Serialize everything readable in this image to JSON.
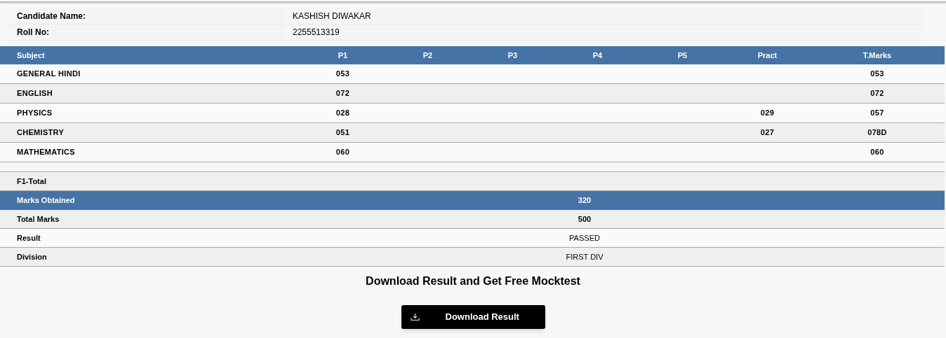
{
  "candidate": [
    {
      "label": "Candidate Name:",
      "value": "KASHISH DIWAKAR"
    },
    {
      "label": "Roll No:",
      "value": "2255513319"
    }
  ],
  "marks_table": {
    "columns": [
      "Subject",
      "P1",
      "P2",
      "P3",
      "P4",
      "P5",
      "Pract",
      "T.Marks"
    ],
    "rows": [
      [
        "GENERAL HINDI",
        "053",
        "",
        "",
        "",
        "",
        "",
        "053"
      ],
      [
        "ENGLISH",
        "072",
        "",
        "",
        "",
        "",
        "",
        "072"
      ],
      [
        "PHYSICS",
        "028",
        "",
        "",
        "",
        "",
        "029",
        "057"
      ],
      [
        "CHEMISTRY",
        "051",
        "",
        "",
        "",
        "",
        "027",
        "078D"
      ],
      [
        "MATHEMATICS",
        "060",
        "",
        "",
        "",
        "",
        "",
        "060"
      ]
    ]
  },
  "summary": [
    {
      "label": "F1-Total",
      "kind": "plain"
    },
    {
      "label": "Marks Obtained",
      "value": "320",
      "kind": "highlight",
      "strong": true
    },
    {
      "label": "Total Marks",
      "value": "500",
      "kind": "plain",
      "strong": true
    },
    {
      "label": "Result",
      "value": "PASSED",
      "kind": "plain",
      "strong": false
    },
    {
      "label": "Division",
      "value": "FIRST DIV",
      "kind": "plain",
      "strong": false
    }
  ],
  "download": {
    "heading": "Download Result and Get Free Mocktest",
    "button": "Download Result"
  }
}
